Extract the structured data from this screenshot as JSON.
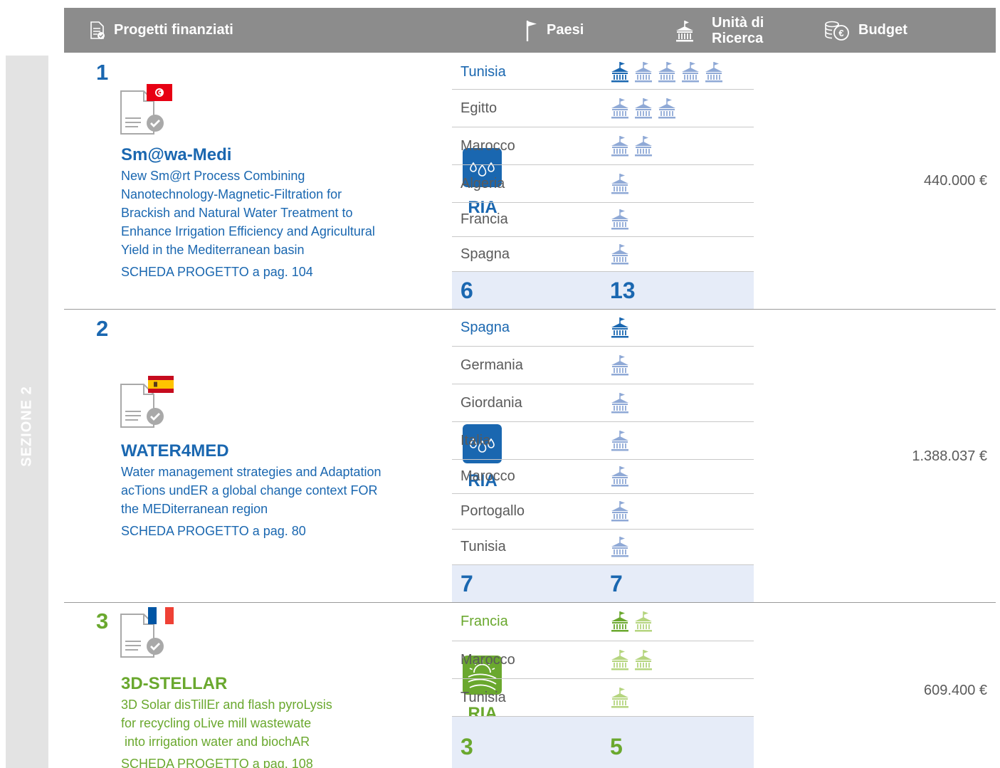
{
  "section_tab": "SEZIONE 2",
  "header": {
    "projects": "Progetti finanziati",
    "countries": "Paesi",
    "research_units_line1": "Unità di",
    "research_units_line2": "Ricerca",
    "budget": "Budget"
  },
  "colors": {
    "blue": "#1a67b0",
    "blue_light": "#8fa9d6",
    "green": "#6aa82e",
    "green_light": "#b5d57f",
    "header_bg": "#8c8c8c"
  },
  "projects": [
    {
      "number": "1",
      "flag": "tunisia-flag",
      "title": "Sm@wa-Medi",
      "description": [
        "New Sm@rt Process Combining",
        "Nanotechnology-Magnetic-Filtration for",
        "Brackish and Natural Water Treatment to",
        "Enhance Irrigation Efficiency and Agricultural",
        "Yield in the Mediterranean basin"
      ],
      "scheda": "SCHEDA PROGETTO a pag. 104",
      "type": "RIA",
      "type_icon": "water-drops-icon",
      "countries": [
        {
          "name": "Tunisia",
          "units": 5
        },
        {
          "name": "Egitto",
          "units": 3
        },
        {
          "name": "Marocco",
          "units": 2
        },
        {
          "name": "Algeria",
          "units": 1
        },
        {
          "name": "Francia",
          "units": 1
        },
        {
          "name": "Spagna",
          "units": 1
        }
      ],
      "total_countries": "6",
      "total_units": "13",
      "budget": "440.000 €"
    },
    {
      "number": "2",
      "flag": "spain-flag",
      "title": "WATER4MED",
      "description": [
        "Water management strategies and Adaptation",
        "acTions undER a global change context FOR",
        "the MEDiterranean region"
      ],
      "scheda": "SCHEDA PROGETTO a pag. 80",
      "type": "RIA",
      "type_icon": "water-drops-icon",
      "countries": [
        {
          "name": "Spagna",
          "units": 1
        },
        {
          "name": "Germania",
          "units": 1
        },
        {
          "name": "Giordania",
          "units": 1
        },
        {
          "name": "Italia",
          "units": 1
        },
        {
          "name": "Marocco",
          "units": 1
        },
        {
          "name": "Portogallo",
          "units": 1
        },
        {
          "name": "Tunisia",
          "units": 1
        }
      ],
      "total_countries": "7",
      "total_units": "7",
      "budget": "1.388.037 €"
    },
    {
      "number": "3",
      "flag": "france-flag",
      "title": "3D-STELLAR",
      "description": [
        "3D Solar disTillEr and flash pyroLysis",
        "for recycling oLive mill wastewate",
        " into irrigation water and biochAR"
      ],
      "scheda": "SCHEDA PROGETTO a pag. 108",
      "type": "RIA",
      "type_icon": "sun-field-icon",
      "countries": [
        {
          "name": "Francia",
          "units": 2
        },
        {
          "name": "Marocco",
          "units": 2
        },
        {
          "name": "Tunisia",
          "units": 1
        }
      ],
      "total_countries": "3",
      "total_units": "5",
      "budget": "609.400 €"
    }
  ]
}
